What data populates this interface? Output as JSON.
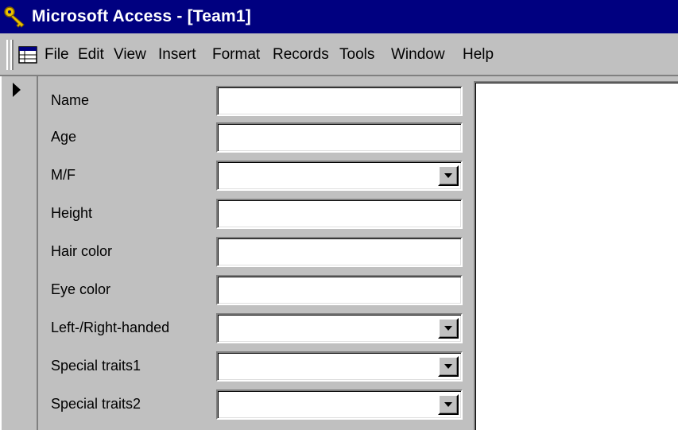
{
  "window": {
    "title": "Microsoft Access - [Team1]",
    "title_bar_color": "#000080",
    "face_color": "#c0c0c0",
    "app_icon": "key-icon"
  },
  "menu": {
    "doc_icon": "datasheet-icon",
    "items": [
      {
        "label": "File"
      },
      {
        "label": "Edit"
      },
      {
        "label": "View"
      },
      {
        "label": "Insert"
      },
      {
        "label": "Format"
      },
      {
        "label": "Records"
      },
      {
        "label": "Tools"
      },
      {
        "label": "Window"
      },
      {
        "label": "Help"
      }
    ]
  },
  "form": {
    "record_selector_icon": "current-record-arrow-icon",
    "fields": [
      {
        "label": "Name",
        "value": "",
        "type": "text"
      },
      {
        "label": "Age",
        "value": "",
        "type": "text"
      },
      {
        "label": "M/F",
        "value": "",
        "type": "combo"
      },
      {
        "label": "Height",
        "value": "",
        "type": "text"
      },
      {
        "label": "Hair color",
        "value": "",
        "type": "text"
      },
      {
        "label": "Eye color",
        "value": "",
        "type": "text"
      },
      {
        "label": "Left-/Right-handed",
        "value": "",
        "type": "combo"
      },
      {
        "label": "Special traits1",
        "value": "",
        "type": "combo"
      },
      {
        "label": "Special traits2",
        "value": "",
        "type": "combo"
      }
    ]
  }
}
